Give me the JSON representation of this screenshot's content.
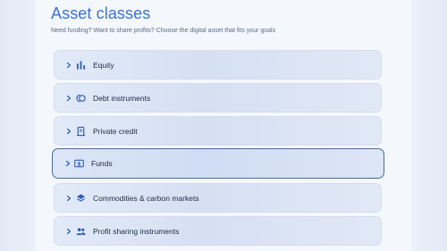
{
  "header": {
    "title": "Asset classes",
    "subtitle": "Need funding? Want to share profits? Choose the digital asset that fits your goals"
  },
  "asset_classes": [
    {
      "label": "Equity",
      "icon": "bar-chart-icon",
      "selected": false
    },
    {
      "label": "Debt instruments",
      "icon": "coins-icon",
      "selected": false
    },
    {
      "label": "Private credit",
      "icon": "receipt-icon",
      "selected": false
    },
    {
      "label": "Funds",
      "icon": "dollar-bill-icon",
      "selected": true
    },
    {
      "label": "Commodities & carbon markets",
      "icon": "layers-icon",
      "selected": false
    },
    {
      "label": "Profit sharing instruments",
      "icon": "people-icon",
      "selected": false
    }
  ],
  "colors": {
    "accent": "#3b73d6",
    "icon": "#2f5fb8",
    "selected_border": "#4a6a9a"
  }
}
